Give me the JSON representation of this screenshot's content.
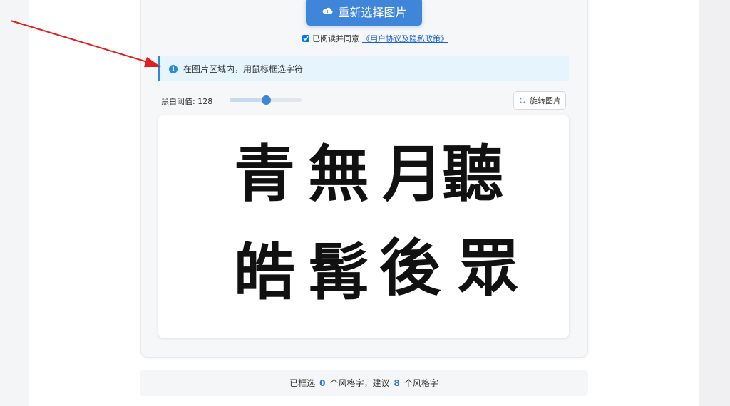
{
  "upload": {
    "label": "重新选择图片"
  },
  "agreement": {
    "text": "已阅读并同意",
    "link": "《用户协议及隐私政策》",
    "checked": true
  },
  "info": {
    "text": "在图片区域内，用鼠标框选字符"
  },
  "threshold": {
    "label": "黑白阈值: 128",
    "value": 128,
    "max": 255
  },
  "rotate": {
    "label": "旋转图片"
  },
  "image": {
    "characters": [
      "青",
      "無",
      "月",
      "聽",
      "皓",
      "髯",
      "後",
      "眾"
    ]
  },
  "footer": {
    "prefix": "已框选",
    "selected": "0",
    "mid": "个风格字，建议",
    "suggested": "8",
    "suffix": "个风格字"
  },
  "colors": {
    "accent": "#3f86db",
    "info_border": "#2b8bd6",
    "annotation_arrow": "#e02020"
  }
}
